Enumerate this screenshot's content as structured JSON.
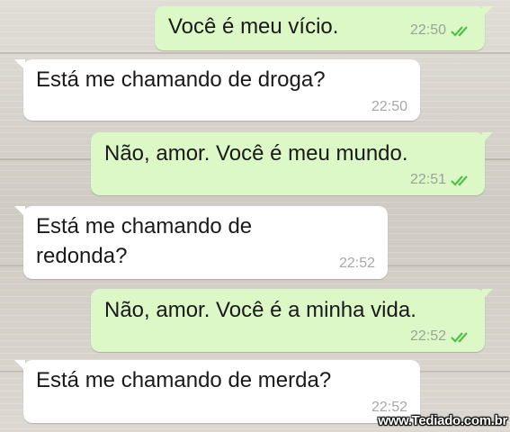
{
  "messages": [
    {
      "direction": "outgoing",
      "text": "Você é meu vício.",
      "time": "22:50",
      "status_icon": "double-check-icon"
    },
    {
      "direction": "incoming",
      "text": "Está me chamando de droga?",
      "time": "22:50"
    },
    {
      "direction": "outgoing",
      "text": "Não, amor. Você é meu mundo.",
      "time": "22:51",
      "status_icon": "double-check-icon"
    },
    {
      "direction": "incoming",
      "lines": [
        "Está me chamando de",
        "redonda?"
      ],
      "time": "22:52"
    },
    {
      "direction": "outgoing",
      "text": "Não, amor. Você é a minha vida.",
      "time": "22:52",
      "status_icon": "double-check-icon"
    },
    {
      "direction": "incoming",
      "text": "Está me chamando de merda?",
      "time": "22:52"
    }
  ],
  "watermark": "www.Tediado.com.br",
  "colors": {
    "outgoing_bubble": "#dcf8c6",
    "incoming_bubble": "#ffffff",
    "tick": "#4fc146"
  }
}
